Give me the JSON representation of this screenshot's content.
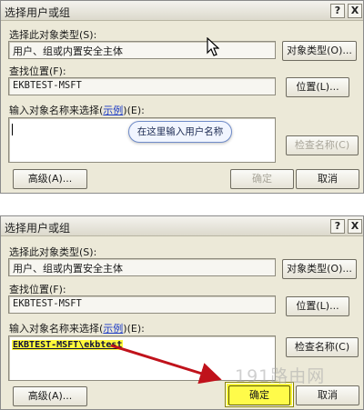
{
  "dialog_top": {
    "title": "选择用户或组",
    "help_glyph": "?",
    "close_glyph": "X",
    "object_type_label": "选择此对象类型(S):",
    "object_type_value": "用户、组或内置安全主体",
    "object_type_button": "对象类型(O)...",
    "location_label": "查找位置(F):",
    "location_value": "EKBTEST-MSFT",
    "location_button": "位置(L)...",
    "names_label_prefix": "输入对象名称来选择(",
    "names_label_link": "示例",
    "names_label_suffix": ")(E):",
    "names_value": "",
    "check_names_button": "检查名称(C)",
    "advanced_button": "高级(A)...",
    "ok_button": "确定",
    "cancel_button": "取消",
    "tooltip_text": "在这里输入用户名称",
    "cursor_icon": "mouse-pointer-icon"
  },
  "dialog_bottom": {
    "title": "选择用户或组",
    "help_glyph": "?",
    "close_glyph": "X",
    "object_type_label": "选择此对象类型(S):",
    "object_type_value": "用户、组或内置安全主体",
    "object_type_button": "对象类型(O)...",
    "location_label": "查找位置(F):",
    "location_value": "EKBTEST-MSFT",
    "location_button": "位置(L)...",
    "names_label_prefix": "输入对象名称来选择(",
    "names_label_link": "示例",
    "names_label_suffix": ")(E):",
    "names_value": "EKBTEST-MSFT\\ekbtest",
    "check_names_button": "检查名称(C)",
    "advanced_button": "高级(A)...",
    "ok_button": "确定",
    "cancel_button": "取消",
    "arrow_icon": "red-arrow-icon"
  },
  "watermark": "191路由网",
  "colors": {
    "dialog_bg": "#ece9d8",
    "highlight": "#fff93a",
    "arrow": "#c0121b",
    "link": "#1a39c4"
  }
}
